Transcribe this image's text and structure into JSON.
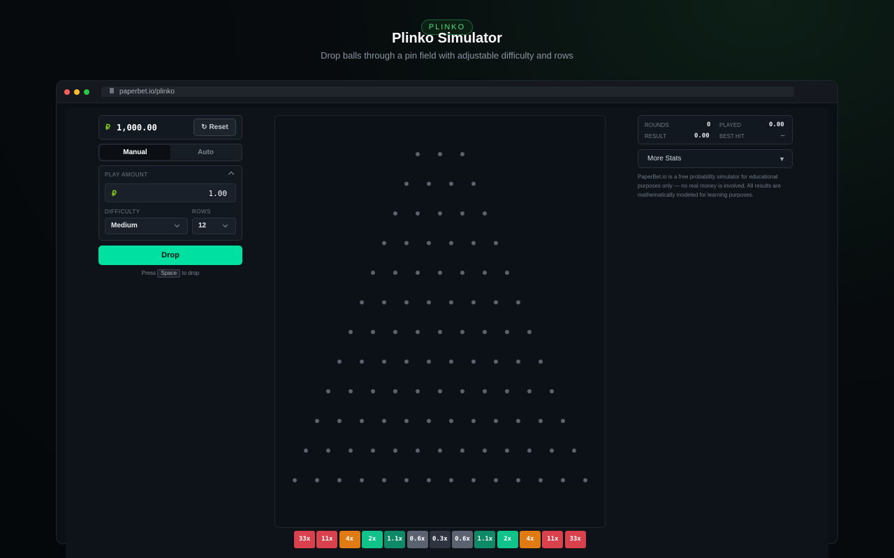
{
  "hero": {
    "badge": "PLINKO",
    "title": "Plinko Simulator",
    "subtitle": "Drop balls through a pin field with adjustable difficulty and rows"
  },
  "browser": {
    "url": "paperbet.io/plinko",
    "dots": [
      "#ff5f57",
      "#febc2e",
      "#28c840"
    ]
  },
  "controls": {
    "coin_icon": "coin-icon",
    "balance": "1,000.00",
    "reset_label": "Reset",
    "tabs": [
      {
        "label": "Manual",
        "active": true
      },
      {
        "label": "Auto",
        "active": false
      }
    ],
    "play_amount_label": "PLAY AMOUNT",
    "play_amount_value": "1.00",
    "difficulty_label": "DIFFICULTY",
    "difficulty_value": "Medium",
    "rows_label": "ROWS",
    "rows_value": "12",
    "drop_label": "Drop",
    "hint_before": "Press",
    "hint_key": "Space",
    "hint_after": "to drop"
  },
  "board": {
    "rows": 12,
    "first_row_pins": 3,
    "pin_color": "#5b636e"
  },
  "multipliers": [
    {
      "label": "33x",
      "color": "#d9414c"
    },
    {
      "label": "11x",
      "color": "#d9414c"
    },
    {
      "label": "4x",
      "color": "#e07a12"
    },
    {
      "label": "2x",
      "color": "#10c489"
    },
    {
      "label": "1.1x",
      "color": "#0e8a66"
    },
    {
      "label": "0.6x",
      "color": "#5b6370"
    },
    {
      "label": "0.3x",
      "color": "#2e3440"
    },
    {
      "label": "0.6x",
      "color": "#5b6370"
    },
    {
      "label": "1.1x",
      "color": "#0e8a66"
    },
    {
      "label": "2x",
      "color": "#10c489"
    },
    {
      "label": "4x",
      "color": "#e07a12"
    },
    {
      "label": "11x",
      "color": "#d9414c"
    },
    {
      "label": "33x",
      "color": "#d9414c"
    }
  ],
  "stats": {
    "rounds_label": "ROUNDS",
    "rounds_value": "0",
    "played_label": "PLAYED",
    "played_value": "0.00",
    "result_label": "RESULT",
    "result_value": "0.00",
    "best_hit_label": "BEST HIT",
    "best_hit_value": "—",
    "more_stats_label": "More Stats",
    "more_stats_icon": "▼"
  },
  "disclaimer": "PaperBet.io is a free probability simulator for educational purposes only — no real money is involved. All results are mathematically modeled for learning purposes."
}
